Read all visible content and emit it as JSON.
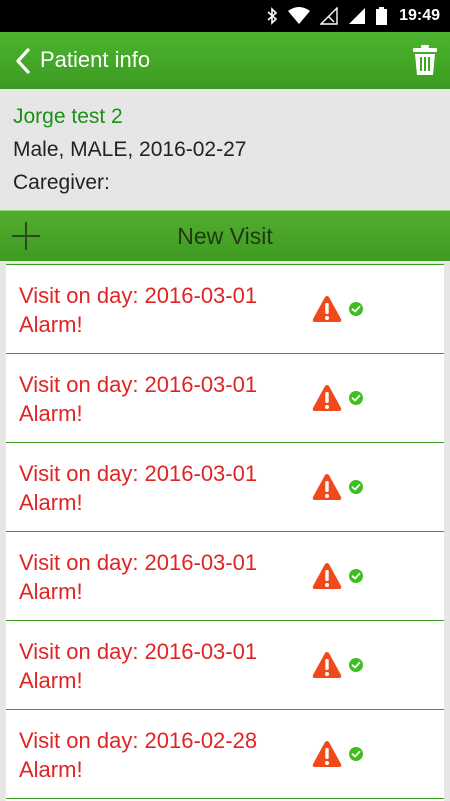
{
  "status_bar": {
    "time": "19:49",
    "icons": [
      "bluetooth-icon",
      "wifi-icon",
      "signal-off-icon",
      "signal-icon",
      "battery-icon"
    ]
  },
  "app_bar": {
    "title": "Patient info",
    "back_icon": "chevron-left-icon",
    "delete_icon": "trash-icon",
    "color": "#43a626"
  },
  "patient": {
    "name": "Jorge test 2",
    "details": "Male, MALE, 2016-02-27",
    "caregiver": "Caregiver:",
    "name_color": "#1c8f16"
  },
  "new_visit": {
    "label": "New Visit",
    "icon": "plus-icon"
  },
  "visits": [
    {
      "title": "Visit on day: 2016-03-01",
      "status": "Alarm!"
    },
    {
      "title": "Visit on day: 2016-03-01",
      "status": "Alarm!"
    },
    {
      "title": "Visit on day: 2016-03-01",
      "status": "Alarm!"
    },
    {
      "title": "Visit on day: 2016-03-01",
      "status": "Alarm!"
    },
    {
      "title": "Visit on day: 2016-03-01",
      "status": "Alarm!"
    },
    {
      "title": "Visit on day: 2016-02-28",
      "status": "Alarm!"
    }
  ],
  "colors": {
    "alarm_text": "#e02424",
    "warning_icon": "#f04a1a",
    "check_icon": "#3fbf1f"
  }
}
